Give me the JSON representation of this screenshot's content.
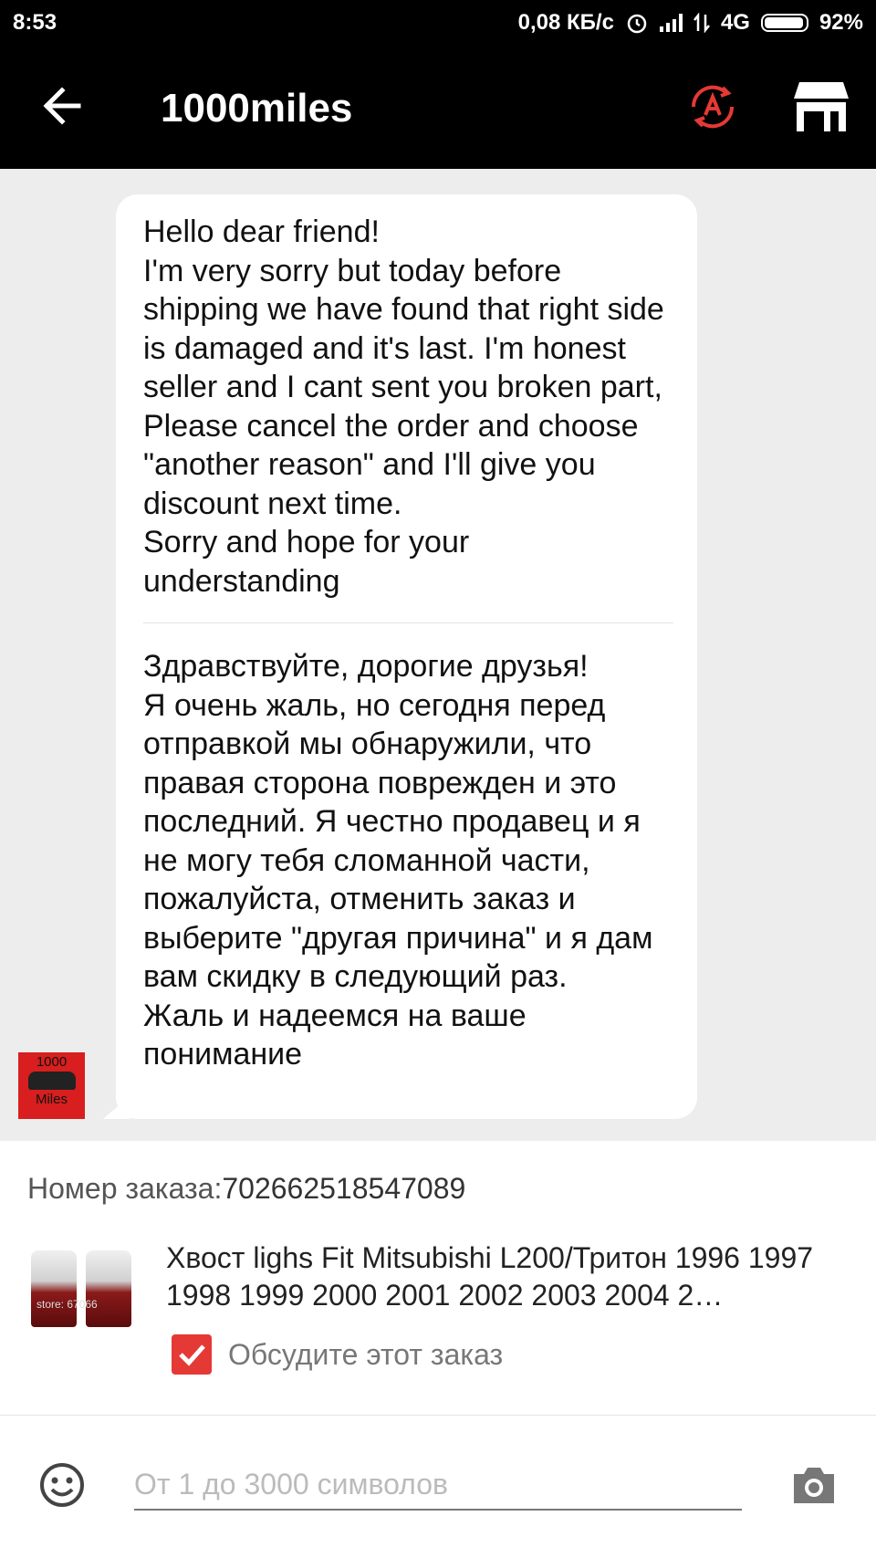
{
  "status_bar": {
    "time": "8:53",
    "speed": "0,08 КБ/с",
    "network": "4G",
    "battery": "92%"
  },
  "header": {
    "title": "1000miles",
    "icons": [
      "back-arrow-icon",
      "translate-icon",
      "store-icon"
    ],
    "accent_color": "#e53935"
  },
  "message": {
    "english": "Hello dear friend!\nI'm very sorry but today before shipping we have found that right side is damaged and it's last. I'm honest seller and I cant sent you broken part, Please cancel the order and choose \"another reason\"  and I'll give you discount next time.\nSorry and hope for your understanding",
    "russian": "Здравствуйте, дорогие друзья!\nЯ очень жаль, но сегодня перед отправкой мы обнаружили, что правая сторона поврежден и это последний. Я честно продавец и я не могу тебя сломанной части, пожалуйста, отменить заказ и выберите \"другая причина\" и я дам вам скидку в следующий раз.\nЖаль и надеемся на ваше понимание",
    "avatar_text_top": "1000",
    "avatar_text_bottom": "Miles"
  },
  "order": {
    "label": "Номер заказа:",
    "number": "702662518547089",
    "product_title": "Хвост lighs Fit Mitsubishi L200/Тритон 1996 1997 1998 1999 2000 2001 2002 2003 2004 2…",
    "image_watermark": "store: 67066",
    "discuss_label": "Обсудите этот заказ",
    "discuss_checked": true
  },
  "composer": {
    "placeholder": "От 1 до 3000 символов"
  }
}
